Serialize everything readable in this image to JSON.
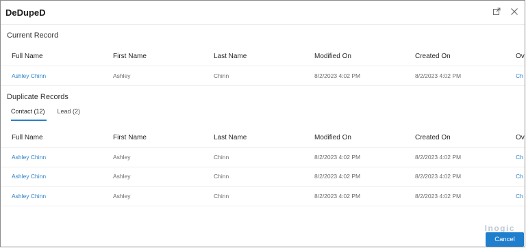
{
  "dialog": {
    "title": "DeDupeD"
  },
  "titlebar_icons": {
    "expand": "expand-icon",
    "close": "close-icon"
  },
  "current_record": {
    "heading": "Current Record",
    "columns": [
      "Full Name",
      "First Name",
      "Last Name",
      "Modified On",
      "Created On",
      "Ov"
    ],
    "row": [
      "Ashley Chinn",
      "Ashley",
      "Chinn",
      "8/2/2023 4:02 PM",
      "8/2/2023 4:02 PM",
      "Ch"
    ]
  },
  "duplicate_records": {
    "heading": "Duplicate Records",
    "tabs": [
      {
        "label": "Contact (12)",
        "active": true
      },
      {
        "label": "Lead (2)",
        "active": false
      }
    ],
    "columns": [
      "Full Name",
      "First Name",
      "Last Name",
      "Modified On",
      "Created On",
      "Ov"
    ],
    "rows": [
      [
        "Ashley Chinn",
        "Ashley",
        "Chinn",
        "8/2/2023 4:02 PM",
        "8/2/2023 4:02 PM",
        "Ch"
      ],
      [
        "Ashley Chinn",
        "Ashley",
        "Chinn",
        "8/2/2023 4:02 PM",
        "8/2/2023 4:02 PM",
        "Ch"
      ],
      [
        "Ashley Chinn",
        "Ashley",
        "Chinn",
        "8/2/2023 4:02 PM",
        "8/2/2023 4:02 PM",
        "Ch"
      ]
    ]
  },
  "footer": {
    "logo_text": "Inogic",
    "cancel_label": "Cancel"
  },
  "colors": {
    "accent": "#1f7fcd",
    "link": "#2a7fc7"
  }
}
